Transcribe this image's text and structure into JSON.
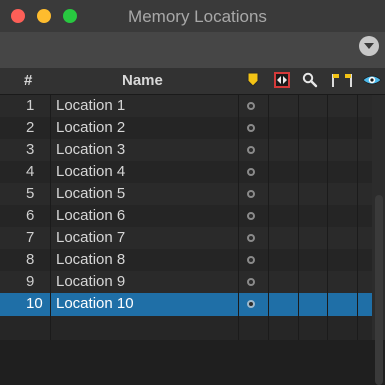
{
  "window": {
    "title": "Memory Locations"
  },
  "header": {
    "num_label": "#",
    "name_label": "Name",
    "icons": [
      "marker-column-icon",
      "selection-column-icon",
      "zoom-column-icon",
      "flag-column-icon",
      "visibility-column-icon"
    ]
  },
  "colors": {
    "selected": "#1f6fa7",
    "marker_icon": "#f3c315",
    "close": "#fd5f57",
    "minimize": "#febc2e",
    "zoom": "#28c840"
  },
  "rows": [
    {
      "num": "1",
      "name": "Location 1"
    },
    {
      "num": "2",
      "name": "Location 2"
    },
    {
      "num": "3",
      "name": "Location 3"
    },
    {
      "num": "4",
      "name": "Location 4"
    },
    {
      "num": "5",
      "name": "Location 5"
    },
    {
      "num": "6",
      "name": "Location 6"
    },
    {
      "num": "7",
      "name": "Location 7"
    },
    {
      "num": "8",
      "name": "Location 8"
    },
    {
      "num": "9",
      "name": "Location 9"
    },
    {
      "num": "10",
      "name": "Location 10"
    }
  ],
  "selected_row": "10"
}
